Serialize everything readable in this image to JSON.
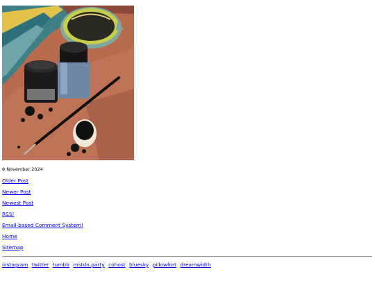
{
  "post": {
    "date": "8 November 2024"
  },
  "nav": {
    "older_post": "Older Post",
    "newer_post": "Newer Post",
    "newest_post": "Newest Post",
    "rss": "RSS!",
    "comments": "Email-based Comment System!",
    "home": "Home",
    "sitemap": "Sitemap"
  },
  "social": [
    "instagram",
    "twitter",
    "tumblr",
    "mstdn.party",
    "cohost",
    "bluesky",
    "pillowfort",
    "dreamwidth"
  ],
  "colors": {
    "link": "#0000ee",
    "divider": "#9a9a9a"
  }
}
